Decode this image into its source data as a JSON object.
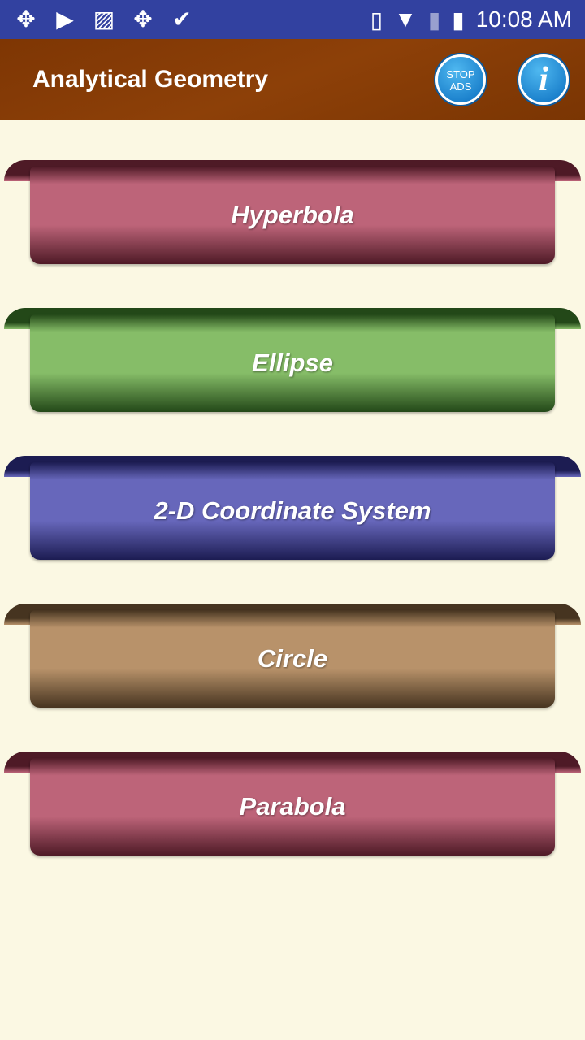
{
  "status_bar": {
    "time": "10:08 AM",
    "notification_icons": [
      "app-icon",
      "youtube-icon",
      "image-icon",
      "app-icon",
      "check-icon"
    ],
    "system_icons": [
      "vibrate-icon",
      "wifi-icon",
      "no-sim-icon",
      "battery-icon"
    ]
  },
  "app_bar": {
    "title": "Analytical Geometry",
    "stop_ads_line1": "STOP",
    "stop_ads_line2": "ADS",
    "info_label": "i"
  },
  "menu": [
    {
      "label": "Hyperbola",
      "color": "#bd6479",
      "dark": "#4e1a26"
    },
    {
      "label": "Ellipse",
      "color": "#86bd68",
      "dark": "#234818"
    },
    {
      "label": "2-D Coordinate System",
      "color": "#6767bb",
      "dark": "#1c1c52"
    },
    {
      "label": "Circle",
      "color": "#b8926a",
      "dark": "#463420"
    },
    {
      "label": "Parabola",
      "color": "#bd6479",
      "dark": "#4e1a26"
    }
  ]
}
